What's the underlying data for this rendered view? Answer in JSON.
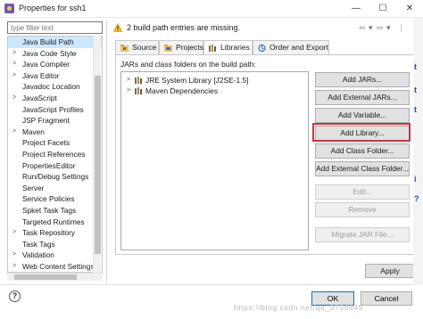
{
  "window": {
    "title": "Properties for ssh1",
    "controls": [
      "—",
      "☐",
      "✕"
    ]
  },
  "filter": {
    "placeholder": "type filter text"
  },
  "tree_items": [
    {
      "label": "Java Build Path",
      "arrow": "",
      "selected": true
    },
    {
      "label": "Java Code Style",
      "arrow": ">"
    },
    {
      "label": "Java Compiler",
      "arrow": ">"
    },
    {
      "label": "Java Editor",
      "arrow": ">"
    },
    {
      "label": "Javadoc Location",
      "arrow": ""
    },
    {
      "label": "JavaScript",
      "arrow": ">"
    },
    {
      "label": "JavaScript Profiles",
      "arrow": ""
    },
    {
      "label": "JSP Fragment",
      "arrow": ""
    },
    {
      "label": "Maven",
      "arrow": ">"
    },
    {
      "label": "Project Facets",
      "arrow": ""
    },
    {
      "label": "Project References",
      "arrow": ""
    },
    {
      "label": "PropertiesEditor",
      "arrow": ""
    },
    {
      "label": "Run/Debug Settings",
      "arrow": ""
    },
    {
      "label": "Server",
      "arrow": ""
    },
    {
      "label": "Service Policies",
      "arrow": ""
    },
    {
      "label": "Spket Task Tags",
      "arrow": ""
    },
    {
      "label": "Targeted Runtimes",
      "arrow": ""
    },
    {
      "label": "Task Repository",
      "arrow": ">"
    },
    {
      "label": "Task Tags",
      "arrow": ""
    },
    {
      "label": "Validation",
      "arrow": ">"
    },
    {
      "label": "Web Content Settings",
      "arrow": ">"
    }
  ],
  "header": {
    "message": "2 build path entries are missing.",
    "nav": [
      "⇦",
      "▾",
      "⇨",
      "▾",
      "⋮"
    ]
  },
  "tabs": [
    {
      "label": "Source",
      "active": false
    },
    {
      "label": "Projects",
      "active": false
    },
    {
      "label": "Libraries",
      "active": true
    },
    {
      "label": "Order and Export",
      "active": false
    }
  ],
  "libraries": {
    "label": "JARs and class folders on the build path:",
    "items": [
      {
        "label": "JRE System Library [J2SE-1.5]"
      },
      {
        "label": "Maven Dependencies"
      }
    ]
  },
  "buttons": [
    {
      "label": "Add JARs...",
      "enabled": true
    },
    {
      "label": "Add External JARs...",
      "enabled": true
    },
    {
      "label": "Add Variable...",
      "enabled": true
    },
    {
      "label": "Add Library...",
      "enabled": true,
      "highlighted": true
    },
    {
      "label": "Add Class Folder...",
      "enabled": true
    },
    {
      "label": "Add External Class Folder...",
      "enabled": true
    },
    {
      "label": "Edit...",
      "enabled": false
    },
    {
      "label": "Remove",
      "enabled": false
    },
    {
      "label": "Migrate JAR File...",
      "enabled": false
    }
  ],
  "footer": {
    "apply": "Apply",
    "ok": "OK",
    "cancel": "Cancel",
    "help": "?"
  },
  "background_marks": [
    "t",
    "t",
    "t",
    "i",
    "?"
  ],
  "watermark": "https://blog.csdn.net/qq_3756849",
  "colors": {
    "selection": "#cce8ff",
    "highlight_border": "#d0323a",
    "ok_border": "#0078d7",
    "warning": "#f2c230"
  }
}
